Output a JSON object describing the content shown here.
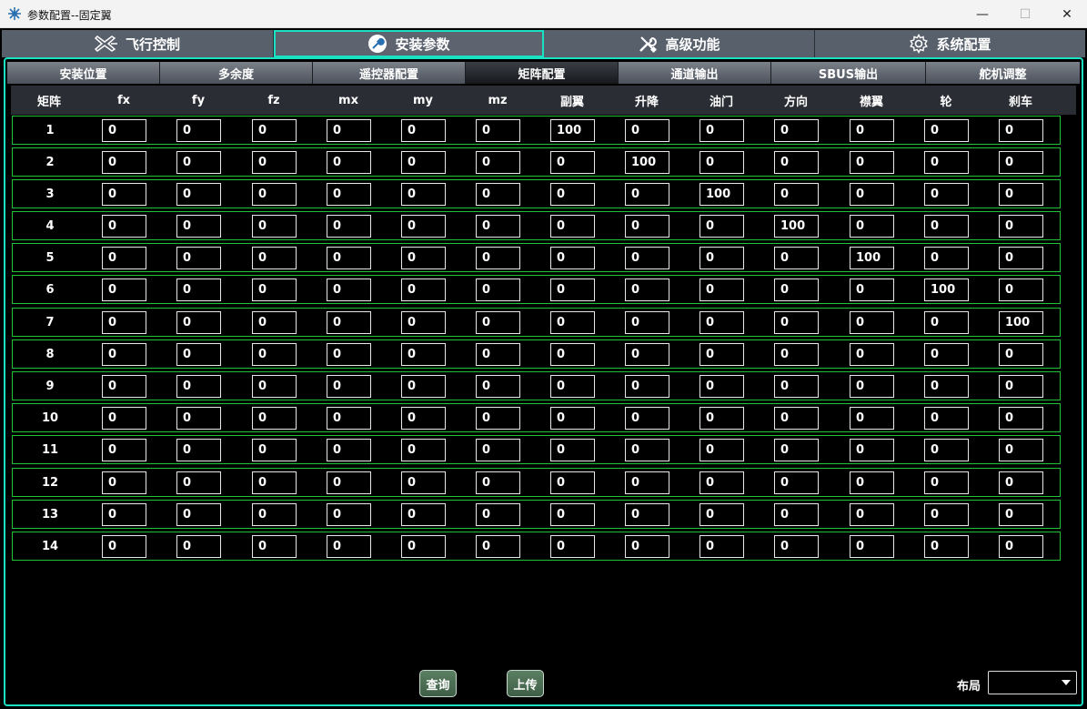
{
  "window": {
    "title": "参数配置--固定翼",
    "minimize": "—",
    "maximize": "☐",
    "close": "✕"
  },
  "main_tabs": [
    {
      "label": "飞行控制",
      "icon": "airplane-icon"
    },
    {
      "label": "安装参数",
      "icon": "wrench-icon"
    },
    {
      "label": "高级功能",
      "icon": "tools-icon"
    },
    {
      "label": "系统配置",
      "icon": "gear-icon"
    }
  ],
  "sub_tabs": [
    "安装位置",
    "多余度",
    "遥控器配置",
    "矩阵配置",
    "通道输出",
    "SBUS输出",
    "舵机调整"
  ],
  "active_sub_tab": "矩阵配置",
  "columns": [
    "矩阵",
    "fx",
    "fy",
    "fz",
    "mx",
    "my",
    "mz",
    "副翼",
    "升降",
    "油门",
    "方向",
    "襟翼",
    "轮",
    "刹车"
  ],
  "rows": [
    {
      "label": "1",
      "values": [
        "0",
        "0",
        "0",
        "0",
        "0",
        "0",
        "100",
        "0",
        "0",
        "0",
        "0",
        "0",
        "0"
      ]
    },
    {
      "label": "2",
      "values": [
        "0",
        "0",
        "0",
        "0",
        "0",
        "0",
        "0",
        "100",
        "0",
        "0",
        "0",
        "0",
        "0"
      ]
    },
    {
      "label": "3",
      "values": [
        "0",
        "0",
        "0",
        "0",
        "0",
        "0",
        "0",
        "0",
        "100",
        "0",
        "0",
        "0",
        "0"
      ]
    },
    {
      "label": "4",
      "values": [
        "0",
        "0",
        "0",
        "0",
        "0",
        "0",
        "0",
        "0",
        "0",
        "100",
        "0",
        "0",
        "0"
      ]
    },
    {
      "label": "5",
      "values": [
        "0",
        "0",
        "0",
        "0",
        "0",
        "0",
        "0",
        "0",
        "0",
        "0",
        "100",
        "0",
        "0"
      ]
    },
    {
      "label": "6",
      "values": [
        "0",
        "0",
        "0",
        "0",
        "0",
        "0",
        "0",
        "0",
        "0",
        "0",
        "0",
        "100",
        "0"
      ]
    },
    {
      "label": "7",
      "values": [
        "0",
        "0",
        "0",
        "0",
        "0",
        "0",
        "0",
        "0",
        "0",
        "0",
        "0",
        "0",
        "100"
      ]
    },
    {
      "label": "8",
      "values": [
        "0",
        "0",
        "0",
        "0",
        "0",
        "0",
        "0",
        "0",
        "0",
        "0",
        "0",
        "0",
        "0"
      ]
    },
    {
      "label": "9",
      "values": [
        "0",
        "0",
        "0",
        "0",
        "0",
        "0",
        "0",
        "0",
        "0",
        "0",
        "0",
        "0",
        "0"
      ]
    },
    {
      "label": "10",
      "values": [
        "0",
        "0",
        "0",
        "0",
        "0",
        "0",
        "0",
        "0",
        "0",
        "0",
        "0",
        "0",
        "0"
      ]
    },
    {
      "label": "11",
      "values": [
        "0",
        "0",
        "0",
        "0",
        "0",
        "0",
        "0",
        "0",
        "0",
        "0",
        "0",
        "0",
        "0"
      ]
    },
    {
      "label": "12",
      "values": [
        "0",
        "0",
        "0",
        "0",
        "0",
        "0",
        "0",
        "0",
        "0",
        "0",
        "0",
        "0",
        "0"
      ]
    },
    {
      "label": "13",
      "values": [
        "0",
        "0",
        "0",
        "0",
        "0",
        "0",
        "0",
        "0",
        "0",
        "0",
        "0",
        "0",
        "0"
      ]
    },
    {
      "label": "14",
      "values": [
        "0",
        "0",
        "0",
        "0",
        "0",
        "0",
        "0",
        "0",
        "0",
        "0",
        "0",
        "0",
        "0"
      ]
    }
  ],
  "buttons": {
    "query": "查询",
    "upload": "上传"
  },
  "layout": {
    "label": "布局",
    "value": ""
  },
  "colors": {
    "accent": "#1ae0c4",
    "row_border": "#22c238",
    "button": "#4a6e52"
  }
}
